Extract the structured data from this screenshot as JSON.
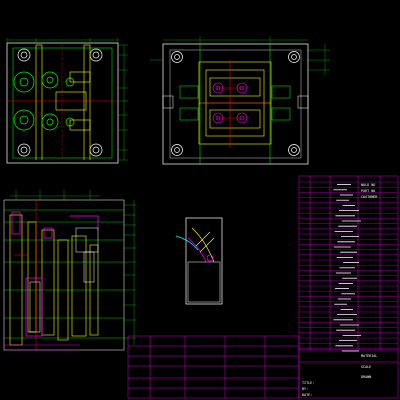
{
  "drawing": {
    "background": "#000000",
    "colors": {
      "outline": "#ffffff",
      "detail": "#00ff00",
      "core": "#ffff00",
      "accent": "#ff00ff",
      "runner": "#ff0000",
      "dim": "#00ff00",
      "table": "#ff00ff",
      "tableText": "#ffffff",
      "annotation": "#00ffff"
    },
    "views": [
      {
        "id": "top-left-plan",
        "name": "Moving half plan view"
      },
      {
        "id": "top-right-plan",
        "name": "Fixed half plan view"
      },
      {
        "id": "section-view",
        "name": "Cross-section view"
      },
      {
        "id": "part-view",
        "name": "Plastic part view"
      }
    ]
  },
  "title_block": {
    "header_rows": [
      "NOLD NO",
      "PART NO",
      "CUSTOMER",
      "MATERIAL",
      "SCALE",
      "DRAWN"
    ],
    "bottom_labels": [
      "TITLE:",
      "BY:",
      "DATE:"
    ]
  }
}
